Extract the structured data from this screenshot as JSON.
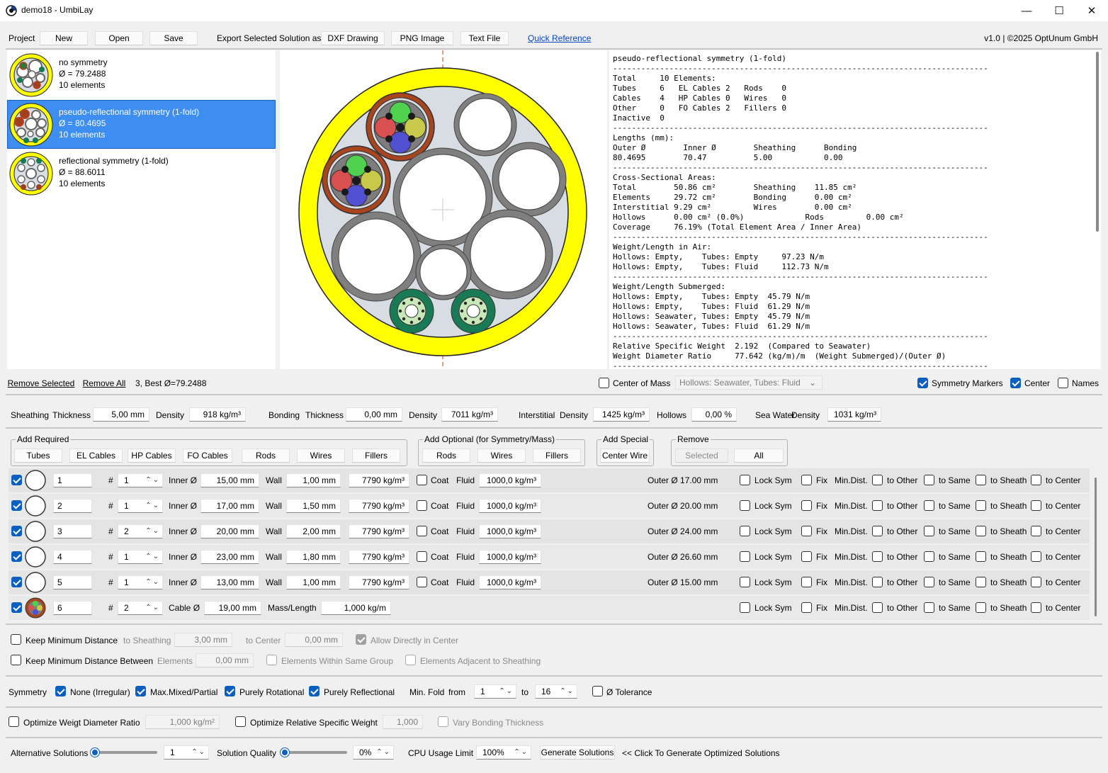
{
  "window": {
    "title": "demo18 - UmbiLay"
  },
  "toolbar": {
    "project": "Project",
    "new": "New",
    "open": "Open",
    "save": "Save",
    "export_label": "Export Selected Solution as",
    "dxf": "DXF Drawing",
    "png": "PNG Image",
    "text": "Text File",
    "quick_ref": "Quick Reference",
    "version": "v1.0 | ©2025 OptUnum GmbH"
  },
  "solutions": [
    {
      "name": "no symmetry",
      "diameter": "Ø = 79.2488",
      "elements": "10 elements"
    },
    {
      "name": "pseudo-reflectional symmetry (1-fold)",
      "diameter": "Ø = 80.4695",
      "elements": "10 elements"
    },
    {
      "name": "reflectional symmetry (1-fold)",
      "diameter": "Ø = 88.6011",
      "elements": "10 elements"
    }
  ],
  "report": {
    "lines": [
      "pseudo-reflectional symmetry (1-fold)",
      "--------------------------------------------------------------------------------",
      "Total     10 Elements:",
      "Tubes     6   EL Cables 2   Rods    0",
      "Cables    4   HP Cables 0   Wires   0",
      "Other     0   FO Cables 2   Fillers 0",
      "Inactive  0",
      "--------------------------------------------------------------------------------",
      "Lengths (mm):",
      "Outer Ø        Inner Ø        Sheathing      Bonding",
      "80.4695        70.47          5.00           0.00",
      "--------------------------------------------------------------------------------",
      "Cross-Sectional Areas:",
      "Total        50.86 cm²        Sheathing    11.85 cm²",
      "Elements     29.72 cm²        Bonding      0.00 cm²",
      "Interstitial 9.29 cm²         Wires        0.00 cm²",
      "Hollows      0.00 cm² (0.0%)             Rods         0.00 cm²",
      "Coverage     76.19% (Total Element Area / Inner Area)",
      "--------------------------------------------------------------------------------",
      "Weight/Length in Air:",
      "Hollows: Empty,    Tubes: Empty     97.23 N/m",
      "Hollows: Empty,    Tubes: Fluid     112.73 N/m",
      "--------------------------------------------------------------------------------",
      "Weight/Length Submerged:",
      "Hollows: Empty,    Tubes: Empty  45.79 N/m",
      "Hollows: Empty,    Tubes: Fluid  61.29 N/m",
      "Hollows: Seawater, Tubes: Empty  45.79 N/m",
      "Hollows: Seawater, Tubes: Fluid  61.29 N/m",
      "--------------------------------------------------------------------------------",
      "Relative Specific Weight  2.192  (Compared to Seawater)",
      "Weight Diameter Ratio     77.642 (kg/m)/m  (Weight Submerged)/(Outer Ø)",
      "--------------------------------------------------------------------------------"
    ]
  },
  "list_actions": {
    "remove_selected": "Remove Selected",
    "remove_all": "Remove All",
    "status": "3, Best Ø=79.2488"
  },
  "view_opts": {
    "center_mass": "Center of Mass",
    "hollows_select": "Hollows: Seawater, Tubes: Fluid",
    "sym_markers": "Symmetry Markers",
    "center": "Center",
    "names": "Names"
  },
  "materials": {
    "sheathing": "Sheathing",
    "thickness": "Thickness",
    "density": "Density",
    "sheath_thickness": "5,00 mm",
    "sheath_density": "918 kg/m³",
    "bonding": "Bonding",
    "bond_thickness": "0,00 mm",
    "bond_density": "7011 kg/m³",
    "interstitial": "Interstitial",
    "inter_density": "1425 kg/m³",
    "hollows": "Hollows",
    "hollows_val": "0,00 %",
    "seawater": "Sea Water",
    "sea_density": "1031 kg/m³"
  },
  "groups": {
    "required": {
      "label": "Add Required",
      "buttons": [
        "Tubes",
        "EL Cables",
        "HP Cables",
        "FO Cables",
        "Rods",
        "Wires",
        "Fillers"
      ]
    },
    "optional": {
      "label": "Add Optional (for Symmetry/Mass)",
      "buttons": [
        "Rods",
        "Wires",
        "Fillers"
      ]
    },
    "special": {
      "label": "Add Special",
      "buttons": [
        "Center Wire"
      ]
    },
    "remove": {
      "label": "Remove",
      "buttons": [
        "Selected",
        "All"
      ]
    }
  },
  "row_labels": {
    "hash": "#",
    "inner": "Inner Ø",
    "wall": "Wall",
    "coat": "Coat",
    "fluid": "Fluid",
    "cable": "Cable Ø",
    "mass": "Mass/Length",
    "lock": "Lock Sym",
    "fix": "Fix",
    "mindist": "Min.Dist.",
    "to_other": "to Other",
    "to_same": "to Same",
    "to_sheath": "to Sheath",
    "to_center": "to Center"
  },
  "elements": [
    {
      "name": "1",
      "count": "1",
      "inner": "15,00 mm",
      "wall": "1,00 mm",
      "density": "7790 kg/m³",
      "fluid": "1000,0 kg/m³",
      "outer": "Outer Ø 17.00 mm"
    },
    {
      "name": "2",
      "count": "1",
      "inner": "17,00 mm",
      "wall": "1,50 mm",
      "density": "7790 kg/m³",
      "fluid": "1000,0 kg/m³",
      "outer": "Outer Ø 20.00 mm"
    },
    {
      "name": "3",
      "count": "2",
      "inner": "20,00 mm",
      "wall": "2,00 mm",
      "density": "7790 kg/m³",
      "fluid": "1000,0 kg/m³",
      "outer": "Outer Ø 24.00 mm"
    },
    {
      "name": "4",
      "count": "1",
      "inner": "23,00 mm",
      "wall": "1,80 mm",
      "density": "7790 kg/m³",
      "fluid": "1000,0 kg/m³",
      "outer": "Outer Ø 26.60 mm"
    },
    {
      "name": "5",
      "count": "1",
      "inner": "13,00 mm",
      "wall": "1,00 mm",
      "density": "7790 kg/m³",
      "fluid": "1000,0 kg/m³",
      "outer": "Outer Ø 15.00 mm"
    }
  ],
  "cable_element": {
    "name": "6",
    "count": "2",
    "cable": "19,00 mm",
    "mass": "1,000 kg/m"
  },
  "distance": {
    "keep_min": "Keep Minimum Distance",
    "to_sheathing": "to Sheathing",
    "sheath_val": "3,00 mm",
    "to_center": "to Center",
    "center_val": "0,00 mm",
    "allow_center": "Allow Directly in Center",
    "keep_between": "Keep Minimum Distance Between",
    "elements": "Elements",
    "elem_val": "0,00 mm",
    "same_group": "Elements Within Same Group",
    "adj_sheath": "Elements Adjacent to Sheathing"
  },
  "symmetry": {
    "label": "Symmetry",
    "none": "None (Irregular)",
    "mixed": "Max.Mixed/Partial",
    "rot": "Purely Rotational",
    "refl": "Purely Reflectional",
    "minfold": "Min. Fold",
    "from": "from",
    "from_val": "1",
    "to": "to",
    "to_val": "16",
    "tolerance": "Ø Tolerance"
  },
  "optimize": {
    "wdr": "Optimize Weigt Diameter Ratio",
    "wdr_val": "1,000 kg/m²",
    "rsw": "Optimize Relative Specific Weight",
    "rsw_val": "1,000",
    "vary": "Vary Bonding Thickness"
  },
  "generate": {
    "alt": "Alternative Solutions",
    "alt_val": "1",
    "quality": "Solution Quality",
    "quality_val": "0%",
    "cpu": "CPU Usage Limit",
    "cpu_val": "100%",
    "gen_btn": "Generate Solutions",
    "hint": "<< Click To Generate Optimized Solutions"
  }
}
